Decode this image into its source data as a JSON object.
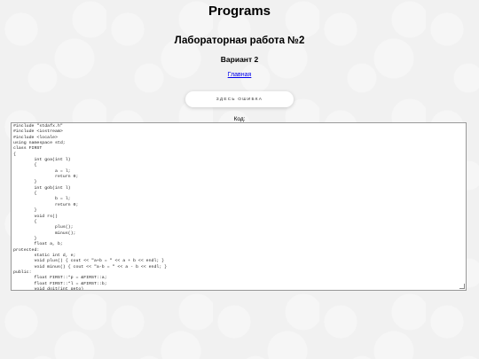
{
  "site": {
    "title": "Programs"
  },
  "lab": {
    "title": "Лабораторная работа №2",
    "variant": "Вариант 2"
  },
  "nav": {
    "home_label": "Главная"
  },
  "actions": {
    "error_button_label": "ЗДЕСЬ ОШИБКА"
  },
  "code_section": {
    "label": "Код:",
    "code": "#include \"stdafx.h\"\n#include <iostream>\n#include <locale>\nusing namespace std;\nclass FIRST\n{\n\tint goa(int l)\n\t{\n\t\ta = l;\n\t\treturn 0;\n\t}\n\tint gob(int l)\n\t{\n\t\tb = l;\n\t\treturn 0;\n\t}\n\tvoid rs()\n\t{\n\t\tplus();\n\t\tminus();\n\t}\n\tfloat a, b;\nprotected:\n\tstatic int d, e;\n\tvoid plus() { cout << \"a+b = \" << a + b << endl; }\n\tvoid minus() { cout << \"a-b = \" << a - b << endl; }\npublic:\n\tfloat FIRST::*p = &FIRST::a;\n\tfloat FIRST::*l = &FIRST::b;\n\tvoid doit(int geto)"
  }
}
